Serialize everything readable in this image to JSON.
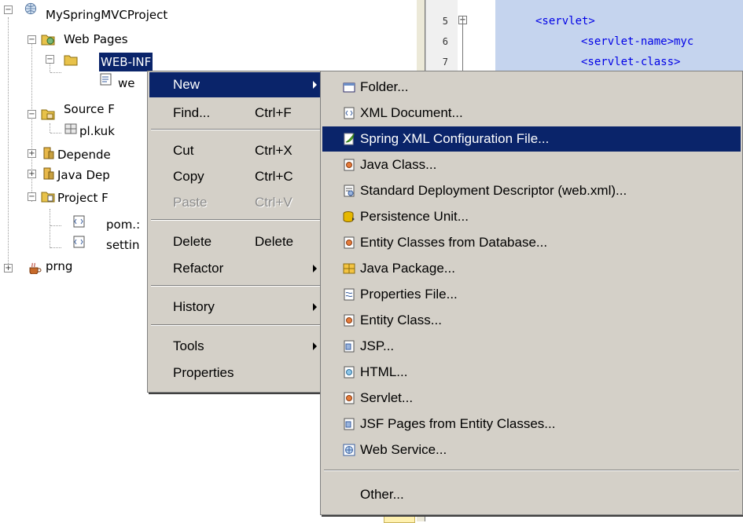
{
  "tree": {
    "items": [
      {
        "label": "MySpringMVCProject"
      },
      {
        "label": "Web Pages"
      },
      {
        "label": "WEB-INF"
      },
      {
        "label": "we"
      },
      {
        "label": "Source F"
      },
      {
        "label": "pl.kuk"
      },
      {
        "label": "Depende"
      },
      {
        "label": "Java Dep"
      },
      {
        "label": "Project F"
      },
      {
        "label": "pom.:"
      },
      {
        "label": "settin"
      },
      {
        "label": "prng"
      }
    ]
  },
  "editor": {
    "line_numbers": [
      "5",
      "6",
      "7"
    ],
    "lines": [
      "<servlet>",
      "<servlet-name>myc",
      "<servlet-class>"
    ]
  },
  "context_menu": {
    "items": [
      {
        "label": "New",
        "shortcut": ""
      },
      {
        "label": "Find...",
        "shortcut": "Ctrl+F"
      },
      {
        "label": "Cut",
        "shortcut": "Ctrl+X"
      },
      {
        "label": "Copy",
        "shortcut": "Ctrl+C"
      },
      {
        "label": "Paste",
        "shortcut": "Ctrl+V"
      },
      {
        "label": "Delete",
        "shortcut": "Delete"
      },
      {
        "label": "Refactor",
        "shortcut": ""
      },
      {
        "label": "History",
        "shortcut": ""
      },
      {
        "label": "Tools",
        "shortcut": ""
      },
      {
        "label": "Properties",
        "shortcut": ""
      }
    ]
  },
  "submenu": {
    "items": [
      {
        "label": "Folder...",
        "icon": "folder-icon"
      },
      {
        "label": "XML Document...",
        "icon": "xml-document-icon"
      },
      {
        "label": "Spring XML Configuration File...",
        "icon": "spring-xml-icon"
      },
      {
        "label": "Java Class...",
        "icon": "java-class-icon"
      },
      {
        "label": "Standard Deployment Descriptor (web.xml)...",
        "icon": "deployment-descriptor-icon"
      },
      {
        "label": "Persistence Unit...",
        "icon": "persistence-unit-icon"
      },
      {
        "label": "Entity Classes from Database...",
        "icon": "entity-classes-icon"
      },
      {
        "label": "Java Package...",
        "icon": "java-package-icon"
      },
      {
        "label": "Properties File...",
        "icon": "properties-file-icon"
      },
      {
        "label": "Entity Class...",
        "icon": "entity-class-icon"
      },
      {
        "label": "JSP...",
        "icon": "jsp-icon"
      },
      {
        "label": "HTML...",
        "icon": "html-icon"
      },
      {
        "label": "Servlet...",
        "icon": "servlet-icon"
      },
      {
        "label": "JSF Pages from Entity Classes...",
        "icon": "jsf-pages-icon"
      },
      {
        "label": "Web Service...",
        "icon": "web-service-icon"
      },
      {
        "label": "Other...",
        "icon": ""
      }
    ]
  },
  "colors": {
    "menu_bg": "#d4d0c8",
    "highlight": "#0a246a",
    "code_selection": "#c5d4ee",
    "code_text": "#0000e6"
  }
}
